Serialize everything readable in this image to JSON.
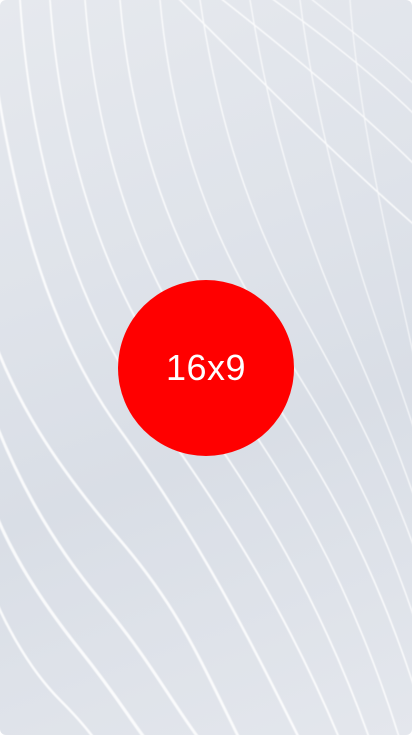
{
  "splash": {
    "logo_text": "16x9",
    "logo_color": "#ff0000",
    "background_style": "white-flowing-lines",
    "background_color": "#dfe3ea"
  }
}
